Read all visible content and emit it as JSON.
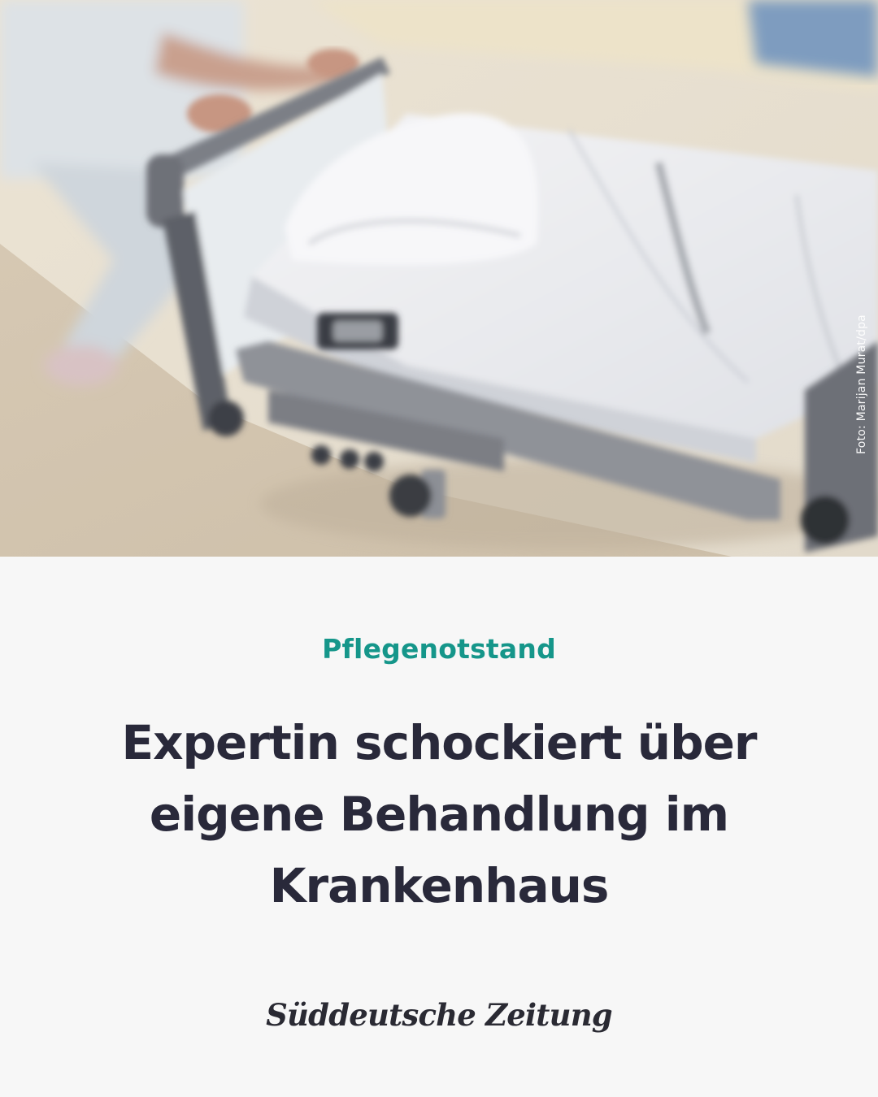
{
  "photo": {
    "alt_subject": "hospital bed being pushed",
    "credit": "Foto: Marijan Murat/dpa"
  },
  "kicker": "Pflegenotstand",
  "headline": "Expertin schockiert über eigene Behandlung im Krankenhaus",
  "brand": {
    "logo_text": "Süddeutsche Zeitung"
  },
  "colors": {
    "kicker": "#15968a",
    "headline": "#29293a",
    "background": "#f7f7f7"
  }
}
